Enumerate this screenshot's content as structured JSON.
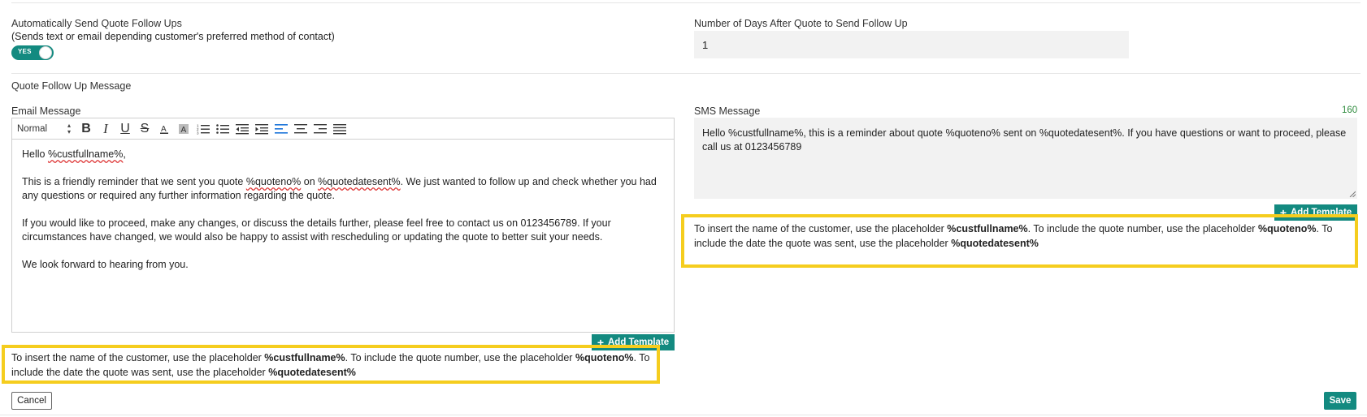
{
  "auto_follow_up": {
    "label": "Automatically Send Quote Follow Ups",
    "sublabel": "(Sends text or email depending customer's preferred method of contact)",
    "toggle_text": "YES",
    "toggle_on": true
  },
  "days_after": {
    "label": "Number of Days After Quote to Send Follow Up",
    "value": "1"
  },
  "section_title": "Quote Follow Up Message",
  "email": {
    "label": "Email Message",
    "toolbar": {
      "format_select": "Normal",
      "buttons": [
        "bold-icon",
        "italic-icon",
        "underline-icon",
        "strikethrough-icon",
        "font-color-icon",
        "background-color-icon",
        "ordered-list-icon",
        "bullet-list-icon",
        "outdent-icon",
        "indent-icon",
        "align-left-icon",
        "align-center-icon",
        "align-right-icon",
        "align-justify-icon"
      ]
    },
    "body": {
      "greeting_prefix": "Hello ",
      "greeting_token": "%custfullname%",
      "greeting_suffix": ",",
      "p1_a": "This is a friendly reminder that we sent you quote ",
      "p1_token1": "%quoteno%",
      "p1_b": " on ",
      "p1_token2": "%quotedatesent%",
      "p1_c": ". We just wanted to follow up and check whether you had any questions or required any further information regarding the quote.",
      "p2": "If you would like to proceed, make any changes, or discuss the details further, please feel free to contact us on 0123456789. If your circumstances have changed, we would also be happy to assist with rescheduling or updating the quote to better suit your needs.",
      "p3": "We look forward to hearing from you."
    },
    "add_template_label": "Add Template"
  },
  "sms": {
    "label": "SMS Message",
    "counter": "160",
    "text": "Hello %custfullname%, this is a reminder about quote %quoteno% sent on %quotedatesent%. If you have questions or want to proceed, please call us at 0123456789",
    "add_template_label": "Add Template"
  },
  "hint": {
    "part1": "To insert the name of the customer, use the placeholder ",
    "token1": "%custfullname%",
    "part2": ".  To include the quote number, use the placeholder ",
    "token2": "%quoteno%",
    "part3": ".  To include the date the quote was sent, use the placeholder ",
    "token3": "%quotedatesent%"
  },
  "colors": {
    "accent": "#138a80",
    "highlight": "#f5cd1e",
    "counter": "#2e8b3d"
  },
  "footer": {
    "cancel_label": "Cancel",
    "save_label": "Save"
  }
}
